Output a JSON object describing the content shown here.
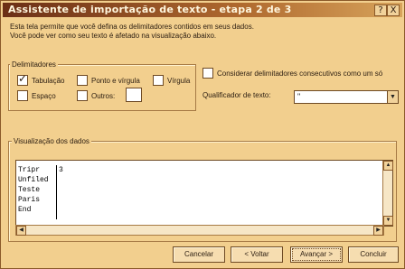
{
  "window": {
    "title": "Assistente de importação de texto - etapa 2 de 3",
    "help_glyph": "?",
    "close_glyph": "X"
  },
  "description": [
    "Esta tela permite que você defina os delimitadores contidos em seus dados.",
    "Você pode ver como seu texto é afetado na visualização abaixo."
  ],
  "delimiters": {
    "label": "Delimitadores",
    "tab": {
      "label": "Tabulação",
      "checked": true
    },
    "semicolon": {
      "label": "Ponto e vírgula",
      "checked": false
    },
    "comma": {
      "label": "Vírgula",
      "checked": false
    },
    "space": {
      "label": "Espaço",
      "checked": false
    },
    "other": {
      "label": "Outros:",
      "checked": false,
      "value": ""
    }
  },
  "consecutive": {
    "label": "Considerar delimitadores consecutivos como um só",
    "checked": false
  },
  "qualifier": {
    "label": "Qualificador de texto:",
    "value": "\""
  },
  "preview": {
    "label": "Visualização dos dados",
    "col1": [
      "Tripr",
      "Unfiled",
      "Teste",
      "Paris",
      "End"
    ],
    "col2": [
      "3",
      "",
      "",
      "",
      ""
    ]
  },
  "buttons": {
    "cancel": "Cancelar",
    "back": "< Voltar",
    "next": "Avançar >",
    "finish": "Concluir"
  },
  "colors": {
    "titlebar": "#6b2f16",
    "window_bg": "#f2cf8e"
  }
}
